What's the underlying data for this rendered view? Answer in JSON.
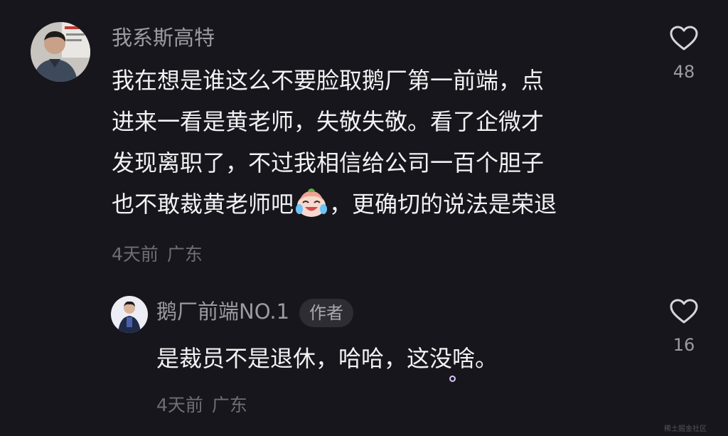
{
  "comment1": {
    "username": "我系斯高特",
    "lines": [
      "我在想是谁这么不要脸取鹅厂第一前端，点",
      "进来一看是黄老师，失敬失敬。看了企微才",
      "发现离职了，不过我相信给公司一百个胆子"
    ],
    "line4_before_emoji": "也不敢裁黄老师吧",
    "line4_after_emoji": "，更确切的说法是荣退",
    "emoji": "crying-laughing-emoji",
    "time": "4天前",
    "location": "广东",
    "likes": "48"
  },
  "reply1": {
    "username": "鹅厂前端NO.1",
    "badge": "作者",
    "text": "是裁员不是退休，哈哈，这没啥。",
    "time": "4天前",
    "location": "广东",
    "likes": "16"
  },
  "watermark": "稀土掘金社区",
  "colors": {
    "background": "#17161c",
    "text": "#f2f2f4",
    "username": "#9c9ba2",
    "meta": "#6f6e75",
    "badge_bg": "#2e2d33"
  }
}
